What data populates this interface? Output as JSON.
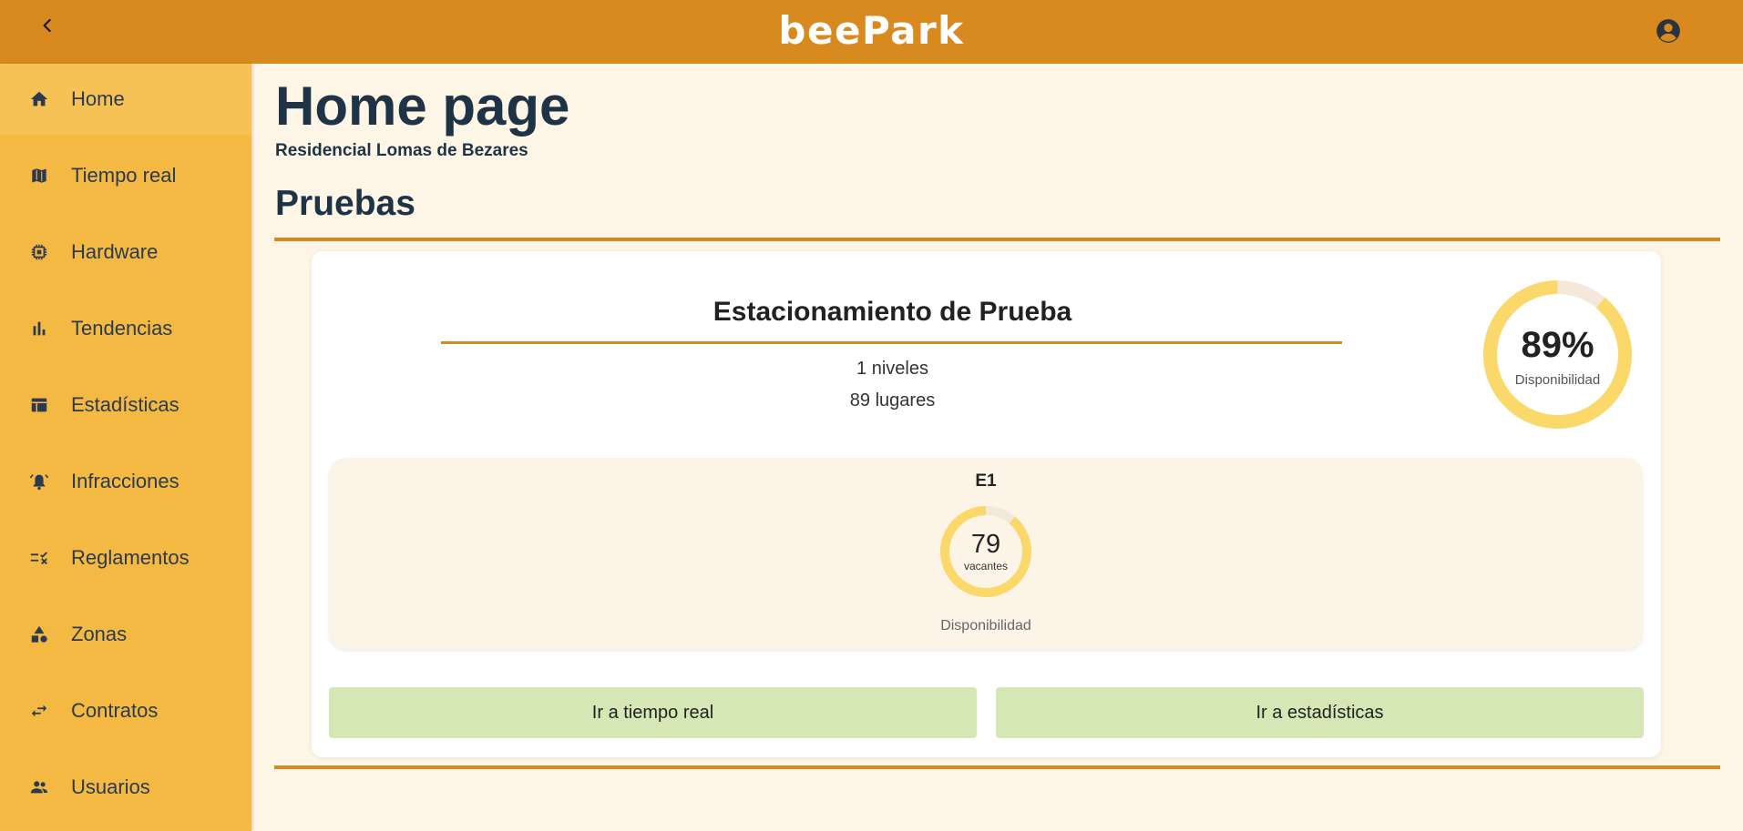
{
  "app": {
    "brand": "beePark"
  },
  "colors": {
    "header": "#d98a1f",
    "sidebar": "#f4b942",
    "sidebar_active": "#f6c255",
    "page_bg": "#fdf5e6",
    "accent_rule": "#d98a1f",
    "donut_fill": "#fad86a",
    "donut_track": "#f3e8d9",
    "button_bg": "#d4e7b4"
  },
  "header": {
    "back_icon": "chevron-left-icon",
    "account_icon": "account-circle-icon"
  },
  "sidebar": {
    "items": [
      {
        "label": "Home",
        "icon": "home-icon",
        "active": true
      },
      {
        "label": "Tiempo real",
        "icon": "map-icon"
      },
      {
        "label": "Hardware",
        "icon": "chip-icon"
      },
      {
        "label": "Tendencias",
        "icon": "bar-chart-icon"
      },
      {
        "label": "Estadísticas",
        "icon": "table-icon"
      },
      {
        "label": "Infracciones",
        "icon": "alarm-bell-icon"
      },
      {
        "label": "Reglamentos",
        "icon": "rule-checklist-icon"
      },
      {
        "label": "Zonas",
        "icon": "shapes-icon"
      },
      {
        "label": "Contratos",
        "icon": "swap-arrows-icon"
      },
      {
        "label": "Usuarios",
        "icon": "people-icon"
      }
    ]
  },
  "main": {
    "title": "Home page",
    "subtitle": "Residencial Lomas de Bezares",
    "section_title": "Pruebas",
    "parking": {
      "name": "Estacionamiento de Prueba",
      "levels_text": "1 niveles",
      "spaces_text": "89 lugares",
      "availability_value": "89%",
      "availability_fraction": 0.89,
      "availability_caption": "Disponibilidad",
      "levels": [
        {
          "name": "E1",
          "vacantes_value": "79",
          "vacantes_label": "vacantes",
          "availability_fraction": 0.89,
          "availability_caption": "Disponibilidad"
        }
      ],
      "buttons": {
        "realtime": "Ir a tiempo real",
        "stats": "Ir a estadísticas"
      }
    }
  }
}
